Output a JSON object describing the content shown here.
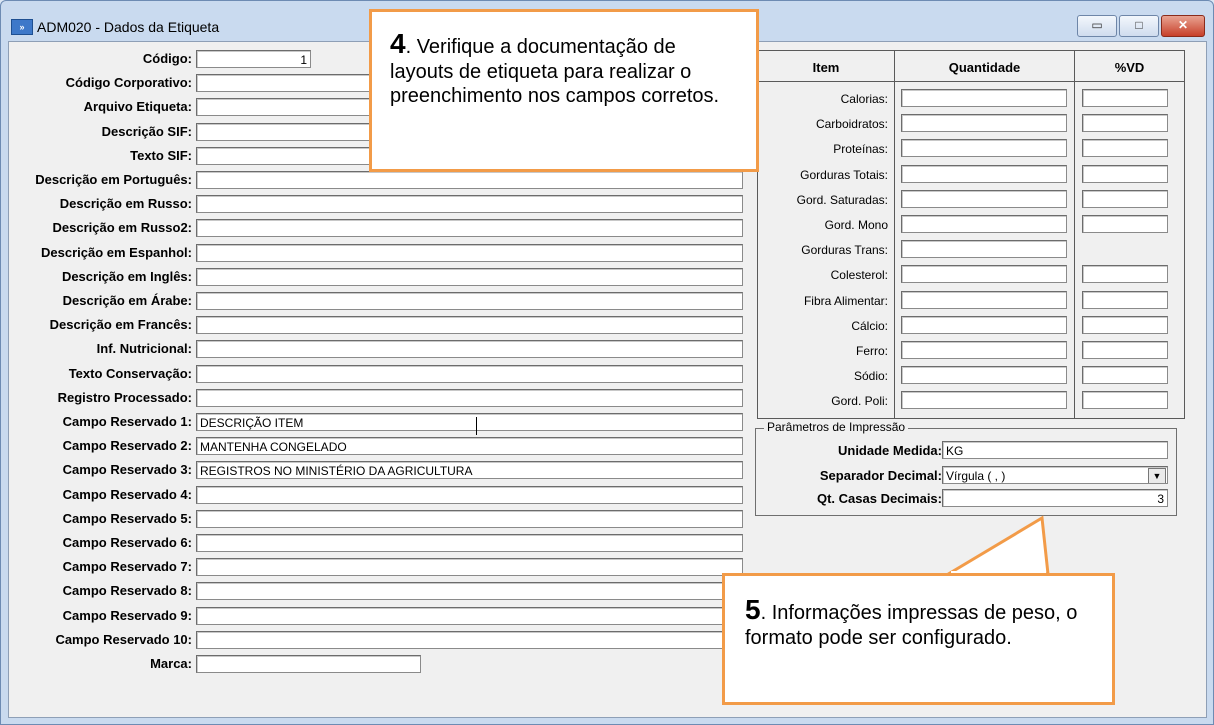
{
  "window": {
    "title": "ADM020 - Dados da Etiqueta",
    "icon": "app-icon",
    "buttons": {
      "minimize": "▭",
      "maximize": "□",
      "close": "✕"
    }
  },
  "form": {
    "fields": [
      {
        "label": "Código:",
        "value": "1"
      },
      {
        "label": "Código Corporativo:",
        "value": ""
      },
      {
        "label": "Arquivo Etiqueta:",
        "value": ""
      },
      {
        "label": "Descrição SIF:",
        "value": ""
      },
      {
        "label": "Texto SIF:",
        "value": ""
      },
      {
        "label": "Descrição em Português:",
        "value": ""
      },
      {
        "label": "Descrição em Russo:",
        "value": ""
      },
      {
        "label": "Descrição em Russo2:",
        "value": ""
      },
      {
        "label": "Descrição em Espanhol:",
        "value": ""
      },
      {
        "label": "Descrição em Inglês:",
        "value": ""
      },
      {
        "label": "Descrição em Árabe:",
        "value": ""
      },
      {
        "label": "Descrição em Francês:",
        "value": ""
      },
      {
        "label": "Inf. Nutricional:",
        "value": ""
      },
      {
        "label": "Texto Conservação:",
        "value": ""
      },
      {
        "label": "Registro Processado:",
        "value": ""
      },
      {
        "label": "Campo Reservado 1:",
        "value": "DESCRIÇÃO ITEM"
      },
      {
        "label": "Campo Reservado 2:",
        "value": "MANTENHA CONGELADO"
      },
      {
        "label": "Campo Reservado 3:",
        "value": "REGISTROS NO MINISTÉRIO DA AGRICULTURA"
      },
      {
        "label": "Campo Reservado 4:",
        "value": ""
      },
      {
        "label": "Campo Reservado 5:",
        "value": ""
      },
      {
        "label": "Campo Reservado 6:",
        "value": ""
      },
      {
        "label": "Campo Reservado 7:",
        "value": ""
      },
      {
        "label": "Campo Reservado 8:",
        "value": ""
      },
      {
        "label": "Campo Reservado 9:",
        "value": ""
      },
      {
        "label": "Campo Reservado 10:",
        "value": ""
      },
      {
        "label": "Marca:",
        "value": ""
      }
    ]
  },
  "nutrition": {
    "headers": {
      "item": "Item",
      "quantity": "Quantidade",
      "vd": "%VD"
    },
    "rows": [
      {
        "label": "Calorias:",
        "quantity": "",
        "vd": ""
      },
      {
        "label": "Carboidratos:",
        "quantity": "",
        "vd": ""
      },
      {
        "label": "Proteínas:",
        "quantity": "",
        "vd": ""
      },
      {
        "label": "Gorduras Totais:",
        "quantity": "",
        "vd": ""
      },
      {
        "label": "Gord. Saturadas:",
        "quantity": "",
        "vd": ""
      },
      {
        "label": "Gord. Mono",
        "quantity": "",
        "vd": ""
      },
      {
        "label": "Gorduras Trans:",
        "quantity": ""
      },
      {
        "label": "Colesterol:",
        "quantity": "",
        "vd": ""
      },
      {
        "label": "Fibra Alimentar:",
        "quantity": "",
        "vd": ""
      },
      {
        "label": "Cálcio:",
        "quantity": "",
        "vd": ""
      },
      {
        "label": "Ferro:",
        "quantity": "",
        "vd": ""
      },
      {
        "label": "Sódio:",
        "quantity": "",
        "vd": ""
      },
      {
        "label": "Gord. Poli:",
        "quantity": "",
        "vd": ""
      }
    ]
  },
  "print_params": {
    "title": "Parâmetros de Impressão",
    "unit_label": "Unidade Medida:",
    "unit_value": "KG",
    "separator_label": "Separador Decimal:",
    "separator_value": "Vírgula ( , )",
    "decimals_label": "Qt. Casas Decimais:",
    "decimals_value": "3"
  },
  "callouts": {
    "c4": {
      "num": "4",
      "text": ". Verifique a documentação de layouts de etiqueta para realizar o preenchimento nos campos corretos."
    },
    "c5": {
      "num": "5",
      "text": ". Informações impressas de peso, o formato pode ser configurado."
    }
  },
  "colors": {
    "callout_border": "#f29b48",
    "window_frame": "#c9daef"
  }
}
